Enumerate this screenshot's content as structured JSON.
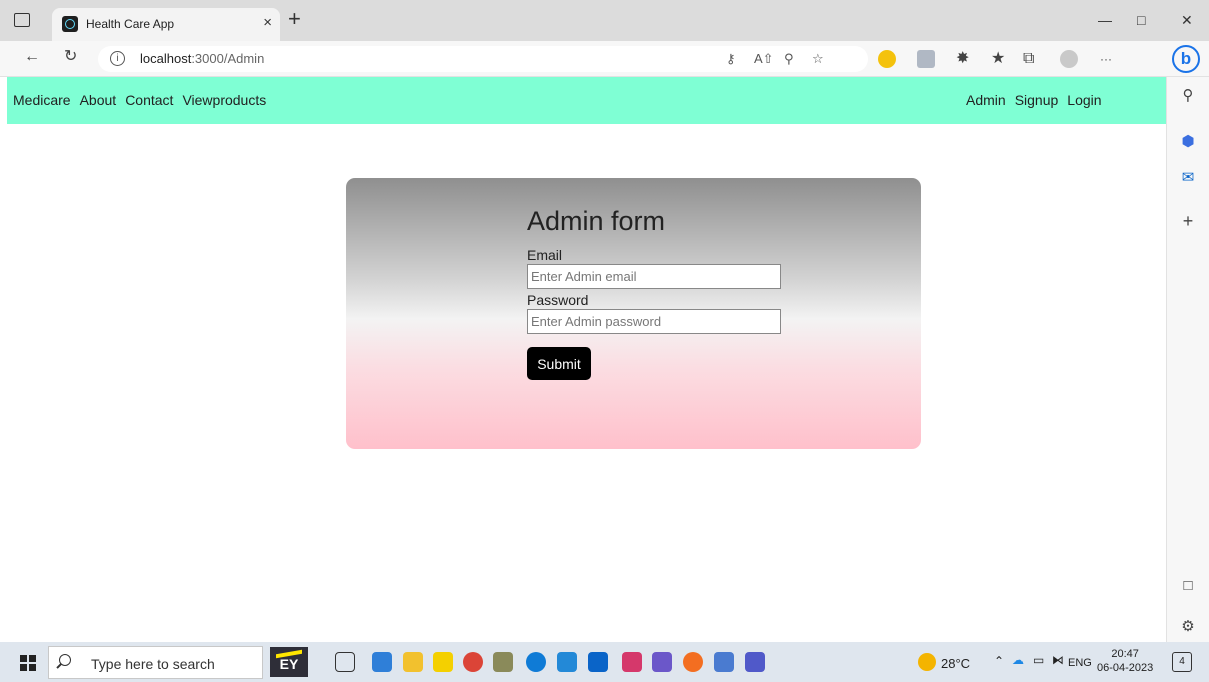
{
  "browser": {
    "tab_title": "Health Care App",
    "tab_close": "×",
    "new_tab": "+",
    "url_host": "localhost",
    "url_path": ":3000/Admin",
    "ellipsis": "···",
    "sidebar_add": "+",
    "bing_letter": "b"
  },
  "navbar": {
    "left_links": [
      "Medicare",
      "About",
      "Contact",
      "Viewproducts"
    ],
    "right_links": [
      "Admin",
      "Signup",
      "Login"
    ]
  },
  "form": {
    "title": "Admin form",
    "email_label": "Email",
    "email_placeholder": "Enter Admin email",
    "password_label": "Password",
    "password_placeholder": "Enter Admin password",
    "submit_label": "Submit"
  },
  "taskbar": {
    "search_placeholder": "Type here to search",
    "ey_label": "EY",
    "weather": "28°C",
    "language": "ENG",
    "time": "20:47",
    "date": "06-04-2023",
    "notification_count": "4"
  },
  "colors": {
    "navbar_bg": "#7fffd4",
    "card_top": "#8f8f8f",
    "card_bottom": "#ffc0cb",
    "submit_bg": "#000000"
  }
}
